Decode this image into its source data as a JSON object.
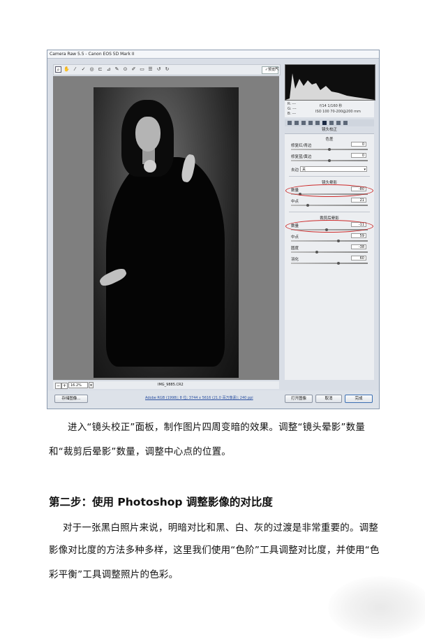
{
  "window": {
    "title": "Camera Raw 5.5 - Canon EOS 5D Mark II",
    "preview_label": "预览",
    "zoom_value": "16.2%",
    "filename": "IMG_9885.CR2",
    "workflow_link": "Adobe RGB (1998); 8 位; 3744 x 5616 (21.0 百万像素); 240 ppi",
    "buttons": {
      "save": "存储图像...",
      "open": "打开图像",
      "cancel": "取消",
      "done": "完成"
    },
    "info": {
      "r": "R: ---",
      "g": "G: ---",
      "b": "B: ---",
      "aperture": "f/14  1/160 秒",
      "iso": "ISO 100  70-200@200 mm"
    },
    "panel": {
      "title": "镜头校正",
      "chromatic_title": "色差",
      "fix_red_cyan": {
        "label": "修复红/青边",
        "value": "0"
      },
      "fix_blue_yellow": {
        "label": "修复蓝/黄边",
        "value": "0"
      },
      "defringe_label": "去边",
      "defringe_value": "关",
      "vignette_title": "镜头晕影",
      "vignette_amount": {
        "label": "数量",
        "value": "-80",
        "level": 0.1
      },
      "vignette_mid": {
        "label": "中点",
        "value": "21",
        "level": 0.2
      },
      "post_crop_title": "裁剪后晕影",
      "pc_amount": {
        "label": "数量",
        "value": "-11",
        "level": 0.45
      },
      "pc_mid": {
        "label": "中点",
        "value": "59",
        "level": 0.6
      },
      "pc_round": {
        "label": "圆度",
        "value": "-38",
        "level": 0.32
      },
      "pc_feather": {
        "label": "羽化",
        "value": "60",
        "level": 0.6
      }
    }
  },
  "text": {
    "para1_line1": "进入“镜头校正”面板，制作图片四周变暗的效果。调整“镜头晕影”数量",
    "para1_line2": "和“裁剪后晕影”数量，调整中心点的位置。",
    "heading": "第二步：使用 Photoshop 调整影像的对比度",
    "para2_line1": "对于一张黑白照片来说，明暗对比和黑、白、灰的过渡是非常重要的。调整",
    "para2_line2": "影像对比度的方法多种多样，这里我们使用“色阶”工具调整对比度，并使用“色",
    "para2_line3": "彩平衡”工具调整照片的色彩。"
  },
  "colors": {
    "highlight_ellipse": "#cc2a2a",
    "link": "#2a4fa0"
  }
}
